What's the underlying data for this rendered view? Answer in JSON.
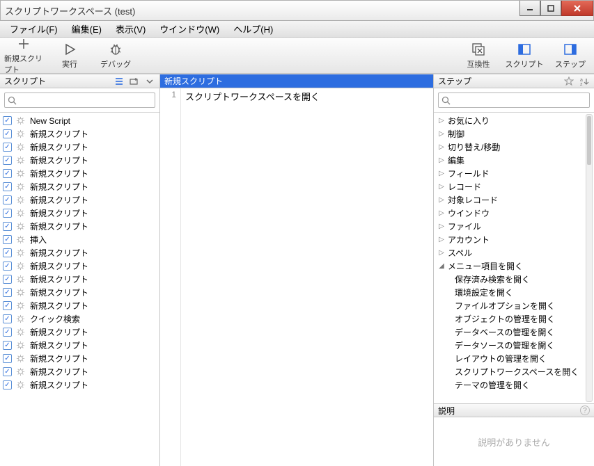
{
  "window": {
    "title": "スクリプトワークスペース (test)"
  },
  "menu": {
    "file": "ファイル(F)",
    "edit": "編集(E)",
    "view": "表示(V)",
    "window": "ウインドウ(W)",
    "help": "ヘルプ(H)"
  },
  "toolbar": {
    "new_script": "新規スクリプト",
    "run": "実行",
    "debug": "デバッグ",
    "compat": "互換性",
    "script": "スクリプト",
    "step": "ステップ"
  },
  "left_panel": {
    "title": "スクリプト",
    "search_placeholder": "",
    "items": [
      {
        "label": "New Script"
      },
      {
        "label": "新規スクリプト"
      },
      {
        "label": "新規スクリプト"
      },
      {
        "label": "新規スクリプト"
      },
      {
        "label": "新規スクリプト"
      },
      {
        "label": "新規スクリプト"
      },
      {
        "label": "新規スクリプト"
      },
      {
        "label": "新規スクリプト"
      },
      {
        "label": "新規スクリプト"
      },
      {
        "label": "挿入"
      },
      {
        "label": "新規スクリプト"
      },
      {
        "label": "新規スクリプト"
      },
      {
        "label": "新規スクリプト"
      },
      {
        "label": "新規スクリプト"
      },
      {
        "label": "新規スクリプト"
      },
      {
        "label": "クイック検索"
      },
      {
        "label": "新規スクリプト"
      },
      {
        "label": "新規スクリプト"
      },
      {
        "label": "新規スクリプト"
      },
      {
        "label": "新規スクリプト"
      },
      {
        "label": "新規スクリプト"
      }
    ]
  },
  "mid_panel": {
    "tab_title": "新規スクリプト",
    "lines": [
      {
        "num": "1",
        "text": "スクリプトワークスペースを開く"
      }
    ]
  },
  "right_panel": {
    "title": "ステップ",
    "search_placeholder": "",
    "categories": [
      {
        "label": "お気に入り",
        "expanded": false
      },
      {
        "label": "制御",
        "expanded": false
      },
      {
        "label": "切り替え/移動",
        "expanded": false
      },
      {
        "label": "編集",
        "expanded": false
      },
      {
        "label": "フィールド",
        "expanded": false
      },
      {
        "label": "レコード",
        "expanded": false
      },
      {
        "label": "対象レコード",
        "expanded": false
      },
      {
        "label": "ウインドウ",
        "expanded": false
      },
      {
        "label": "ファイル",
        "expanded": false
      },
      {
        "label": "アカウント",
        "expanded": false
      },
      {
        "label": "スペル",
        "expanded": false
      },
      {
        "label": "メニュー項目を開く",
        "expanded": true,
        "children": [
          "保存済み検索を開く",
          "環境設定を開く",
          "ファイルオプションを開く",
          "オブジェクトの管理を開く",
          "データベースの管理を開く",
          "データソースの管理を開く",
          "レイアウトの管理を開く",
          "スクリプトワークスペースを開く",
          "テーマの管理を開く"
        ]
      }
    ]
  },
  "description": {
    "title": "説明",
    "placeholder": "説明がありません"
  }
}
